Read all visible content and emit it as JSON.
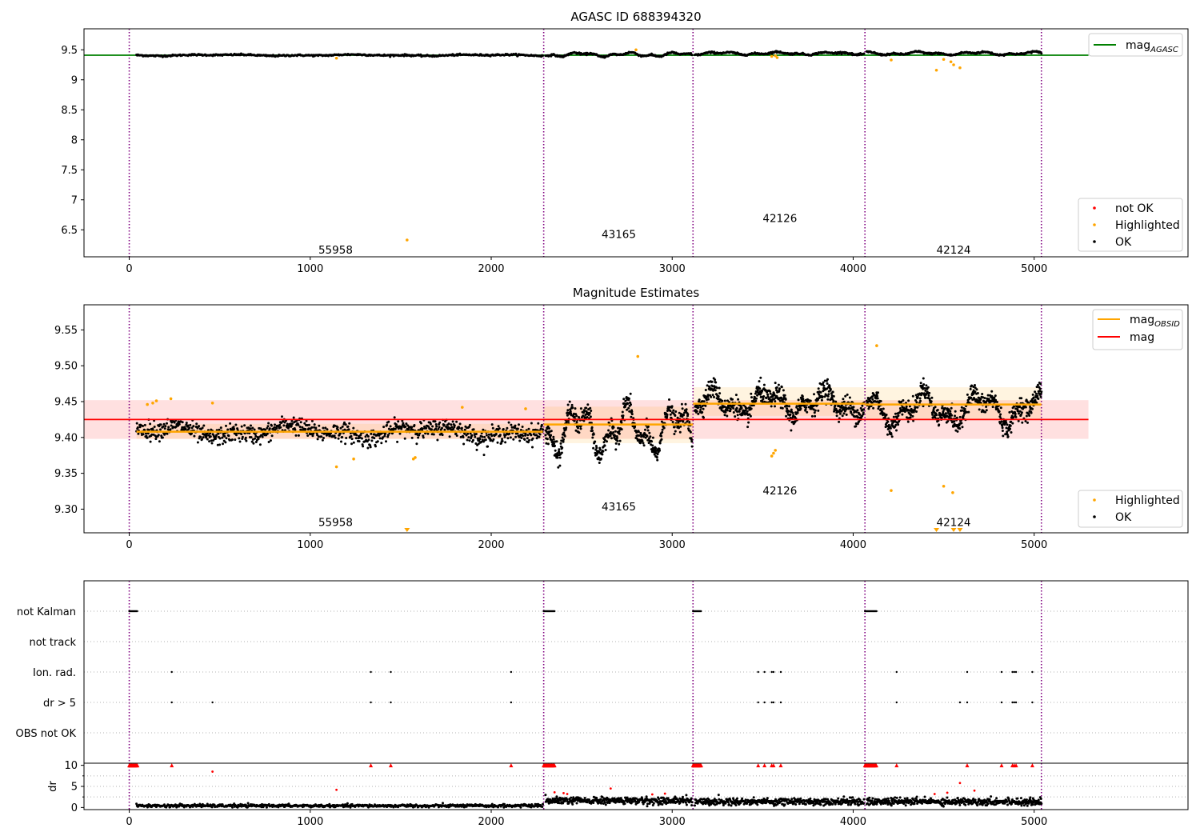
{
  "chart_data": [
    {
      "type": "scatter",
      "title": "AGASC ID 688394320",
      "xlim": [
        -250,
        5850
      ],
      "ylim": [
        6.05,
        9.85
      ],
      "x_ticks": [
        0,
        1000,
        2000,
        3000,
        4000,
        5000
      ],
      "y_ticks": [
        6.5,
        7.0,
        7.5,
        8.0,
        8.5,
        9.0,
        9.5
      ],
      "obsid_boundaries": [
        0,
        2290,
        3115,
        4065,
        5040
      ],
      "obsid_labels": [
        {
          "text": "55958",
          "x": 1140,
          "y": 6.17
        },
        {
          "text": "43165",
          "x": 2705,
          "y": 6.43
        },
        {
          "text": "42126",
          "x": 3595,
          "y": 6.7
        },
        {
          "text": "42124",
          "x": 4555,
          "y": 6.17
        }
      ],
      "reference_lines": [
        {
          "name": "mag_AGASC",
          "y": 9.41,
          "x": [
            -250,
            5300
          ],
          "color": "#008000"
        }
      ],
      "segments": [
        {
          "x0": 40,
          "x1": 2285,
          "center": 9.41,
          "amp": 0.012,
          "noise": 0.01,
          "n": 560
        },
        {
          "x0": 2300,
          "x1": 3110,
          "center": 9.42,
          "amp": 0.04,
          "noise": 0.01,
          "n": 240
        },
        {
          "x0": 3125,
          "x1": 4060,
          "center": 9.44,
          "amp": 0.025,
          "noise": 0.01,
          "n": 280
        },
        {
          "x0": 4075,
          "x1": 5040,
          "center": 9.44,
          "amp": 0.03,
          "noise": 0.01,
          "n": 300
        }
      ],
      "highlighted_points": [
        {
          "x": 1145,
          "y": 9.36
        },
        {
          "x": 1535,
          "y": 6.33
        },
        {
          "x": 2800,
          "y": 9.5
        },
        {
          "x": 3550,
          "y": 9.39
        },
        {
          "x": 3570,
          "y": 9.4
        },
        {
          "x": 3580,
          "y": 9.37
        },
        {
          "x": 4210,
          "y": 9.33
        },
        {
          "x": 4460,
          "y": 9.16
        },
        {
          "x": 4500,
          "y": 9.34
        },
        {
          "x": 4540,
          "y": 9.3
        },
        {
          "x": 4555,
          "y": 9.25
        },
        {
          "x": 4590,
          "y": 9.2
        }
      ],
      "legend": {
        "line_entries": [
          {
            "label": "mag",
            "sub": "AGASC",
            "color": "#008000"
          }
        ],
        "marker_entries": [
          {
            "label": "not OK",
            "color": "#ff0000"
          },
          {
            "label": "Highlighted",
            "color": "#ffa500"
          },
          {
            "label": "OK",
            "color": "#000000"
          }
        ]
      }
    },
    {
      "type": "scatter",
      "title": "Magnitude Estimates",
      "xlim": [
        -250,
        5850
      ],
      "ylim": [
        9.267,
        9.585
      ],
      "x_ticks": [
        0,
        1000,
        2000,
        3000,
        4000,
        5000
      ],
      "y_ticks": [
        9.3,
        9.35,
        9.4,
        9.45,
        9.5,
        9.55
      ],
      "y_tick_labels": [
        "9.30",
        "9.35",
        "9.40",
        "9.45",
        "9.50",
        "9.55"
      ],
      "obsid_boundaries": [
        0,
        2290,
        3115,
        4065,
        5040
      ],
      "obsid_labels": [
        {
          "text": "55958",
          "x": 1140,
          "y": 9.282
        },
        {
          "text": "43165",
          "x": 2705,
          "y": 9.304
        },
        {
          "text": "42126",
          "x": 3595,
          "y": 9.326
        },
        {
          "text": "42124",
          "x": 4555,
          "y": 9.282
        }
      ],
      "mag": {
        "y": 9.425,
        "band": [
          9.398,
          9.452
        ],
        "x": [
          -250,
          5300
        ],
        "color": "#ff0000"
      },
      "mag_obsid": [
        {
          "x": [
            40,
            2285
          ],
          "y": 9.408,
          "band": [
            9.398,
            9.419
          ]
        },
        {
          "x": [
            2290,
            3115
          ],
          "y": 9.418,
          "band": [
            9.392,
            9.443
          ]
        },
        {
          "x": [
            3115,
            4065
          ],
          "y": 9.447,
          "band": [
            9.43,
            9.47
          ]
        },
        {
          "x": [
            4065,
            5040
          ],
          "y": 9.446,
          "band": [
            9.425,
            9.47
          ]
        }
      ],
      "segments": [
        {
          "x0": 40,
          "x1": 2285,
          "center": 9.408,
          "amp": 0.01,
          "noise": 0.009,
          "n": 900
        },
        {
          "x0": 2300,
          "x1": 3110,
          "center": 9.41,
          "amp": 0.04,
          "noise": 0.01,
          "n": 520
        },
        {
          "x0": 3125,
          "x1": 4060,
          "center": 9.448,
          "amp": 0.022,
          "noise": 0.01,
          "n": 600
        },
        {
          "x0": 4075,
          "x1": 5040,
          "center": 9.44,
          "amp": 0.028,
          "noise": 0.01,
          "n": 620
        }
      ],
      "highlighted_points": [
        {
          "x": 100,
          "y": 9.446
        },
        {
          "x": 130,
          "y": 9.448
        },
        {
          "x": 150,
          "y": 9.451
        },
        {
          "x": 230,
          "y": 9.454
        },
        {
          "x": 460,
          "y": 9.448
        },
        {
          "x": 1145,
          "y": 9.359
        },
        {
          "x": 1240,
          "y": 9.37
        },
        {
          "x": 1570,
          "y": 9.37
        },
        {
          "x": 1580,
          "y": 9.372
        },
        {
          "x": 1840,
          "y": 9.442
        },
        {
          "x": 2190,
          "y": 9.44
        },
        {
          "x": 2810,
          "y": 9.513
        },
        {
          "x": 3550,
          "y": 9.374
        },
        {
          "x": 3560,
          "y": 9.378
        },
        {
          "x": 3570,
          "y": 9.382
        },
        {
          "x": 4130,
          "y": 9.528
        },
        {
          "x": 4210,
          "y": 9.326
        },
        {
          "x": 4500,
          "y": 9.332
        },
        {
          "x": 4550,
          "y": 9.323
        }
      ],
      "highlighted_offscale": [
        1535,
        4460,
        4555,
        4590
      ],
      "legend": {
        "line_entries": [
          {
            "label": "mag",
            "sub": "OBSID",
            "color": "#ffa500"
          },
          {
            "label": "mag",
            "sub": "",
            "color": "#ff0000"
          }
        ],
        "marker_entries": [
          {
            "label": "Highlighted",
            "color": "#ffa500"
          },
          {
            "label": "OK",
            "color": "#000000"
          }
        ]
      }
    },
    {
      "type": "scatter",
      "xlim": [
        -250,
        5850
      ],
      "categories": [
        "not Kalman",
        "not track",
        "Ion. rad.",
        "dr > 5",
        "OBS not OK"
      ],
      "obsid_boundaries": [
        0,
        2290,
        3115,
        4065,
        5040
      ],
      "flags": {
        "not Kalman": {
          "ranges": [
            [
              0,
              45
            ],
            [
              2290,
              2350
            ],
            [
              3115,
              3160
            ],
            [
              4065,
              4130
            ]
          ]
        },
        "not track": {
          "points": []
        },
        "Ion. rad.": {
          "points": [
            235,
            1335,
            1445,
            2110,
            3475,
            3510,
            3550,
            3560,
            3600,
            4240,
            4630,
            4820,
            4880,
            4890,
            4900,
            4990
          ]
        },
        "dr > 5": {
          "points": [
            235,
            460,
            1335,
            1445,
            2110,
            3475,
            3510,
            3550,
            3560,
            3600,
            4240,
            4590,
            4630,
            4820,
            4880,
            4890,
            4900,
            4990
          ]
        },
        "OBS not OK": {
          "points": []
        }
      }
    },
    {
      "type": "scatter",
      "ylabel": "dr",
      "xlim": [
        -250,
        5850
      ],
      "ylim": [
        -0.5,
        10.5
      ],
      "x_ticks": [
        0,
        1000,
        2000,
        3000,
        4000,
        5000
      ],
      "y_ticks": [
        0,
        5,
        10
      ],
      "obsid_boundaries": [
        0,
        2290,
        3115,
        4065,
        5040
      ],
      "segments": [
        {
          "x0": 40,
          "x1": 2285,
          "center": 0.4,
          "noise": 0.25,
          "n": 700
        },
        {
          "x0": 2300,
          "x1": 3110,
          "center": 1.6,
          "noise": 0.6,
          "n": 380
        },
        {
          "x0": 3125,
          "x1": 4060,
          "center": 1.4,
          "noise": 0.6,
          "n": 420
        },
        {
          "x0": 4075,
          "x1": 5040,
          "center": 1.4,
          "noise": 0.6,
          "n": 440
        }
      ],
      "capped_ranges": [
        [
          0,
          45
        ],
        [
          2290,
          2350
        ],
        [
          3115,
          3160
        ],
        [
          4065,
          4130
        ]
      ],
      "capped_points": [
        235,
        1335,
        1445,
        2110,
        3475,
        3510,
        3550,
        3560,
        3600,
        4240,
        4630,
        4820,
        4880,
        4890,
        4900,
        4990
      ],
      "red_points": [
        {
          "x": 460,
          "y": 8.5
        },
        {
          "x": 1145,
          "y": 4.2
        },
        {
          "x": 2350,
          "y": 3.6
        },
        {
          "x": 2400,
          "y": 3.4
        },
        {
          "x": 2420,
          "y": 3.2
        },
        {
          "x": 2660,
          "y": 4.5
        },
        {
          "x": 2890,
          "y": 3.1
        },
        {
          "x": 2960,
          "y": 3.3
        },
        {
          "x": 4590,
          "y": 5.8
        },
        {
          "x": 4670,
          "y": 4.0
        },
        {
          "x": 4450,
          "y": 3.2
        },
        {
          "x": 4520,
          "y": 3.5
        }
      ]
    }
  ]
}
